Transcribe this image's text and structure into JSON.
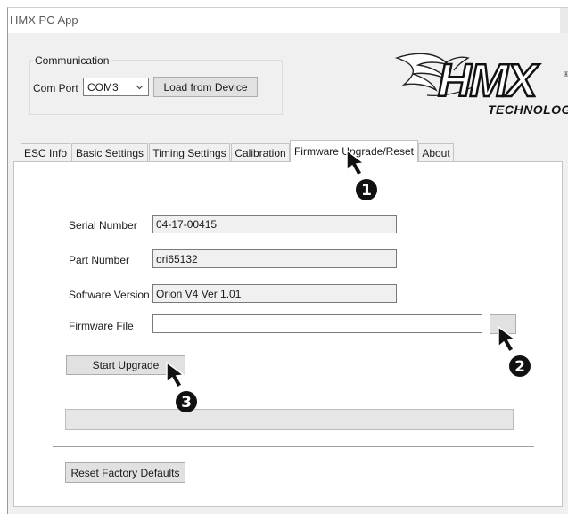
{
  "window": {
    "title": "HMX PC App"
  },
  "communication": {
    "group_label": "Communication",
    "com_port_label": "Com Port",
    "com_port_value": "COM3",
    "load_button": "Load from Device"
  },
  "logo": {
    "brand": "HMX",
    "tagline": "TECHNOLOGY"
  },
  "tabs": [
    {
      "label": "ESC Info",
      "active": false
    },
    {
      "label": "Basic Settings",
      "active": false
    },
    {
      "label": "Timing Settings",
      "active": false
    },
    {
      "label": "Calibration",
      "active": false
    },
    {
      "label": "Firmware Upgrade/Reset",
      "active": true
    },
    {
      "label": "About",
      "active": false
    }
  ],
  "firmware": {
    "serial_number_label": "Serial Number",
    "serial_number_value": "04-17-00415",
    "part_number_label": "Part Number",
    "part_number_value": "ori65132",
    "software_version_label": "Software Version",
    "software_version_value": "Orion V4 Ver 1.01",
    "firmware_file_label": "Firmware File",
    "firmware_file_value": "",
    "browse_button": "",
    "start_upgrade_button": "Start Upgrade",
    "progress_percent": 0,
    "reset_button": "Reset Factory Defaults"
  },
  "callouts": [
    "1",
    "2",
    "3"
  ],
  "colors": {
    "window_bg": "#f0f0f0",
    "panel_bg": "#ffffff",
    "button_bg": "#e1e1e1",
    "callout_fill": "#111111",
    "progress_fill": "#06b025"
  }
}
